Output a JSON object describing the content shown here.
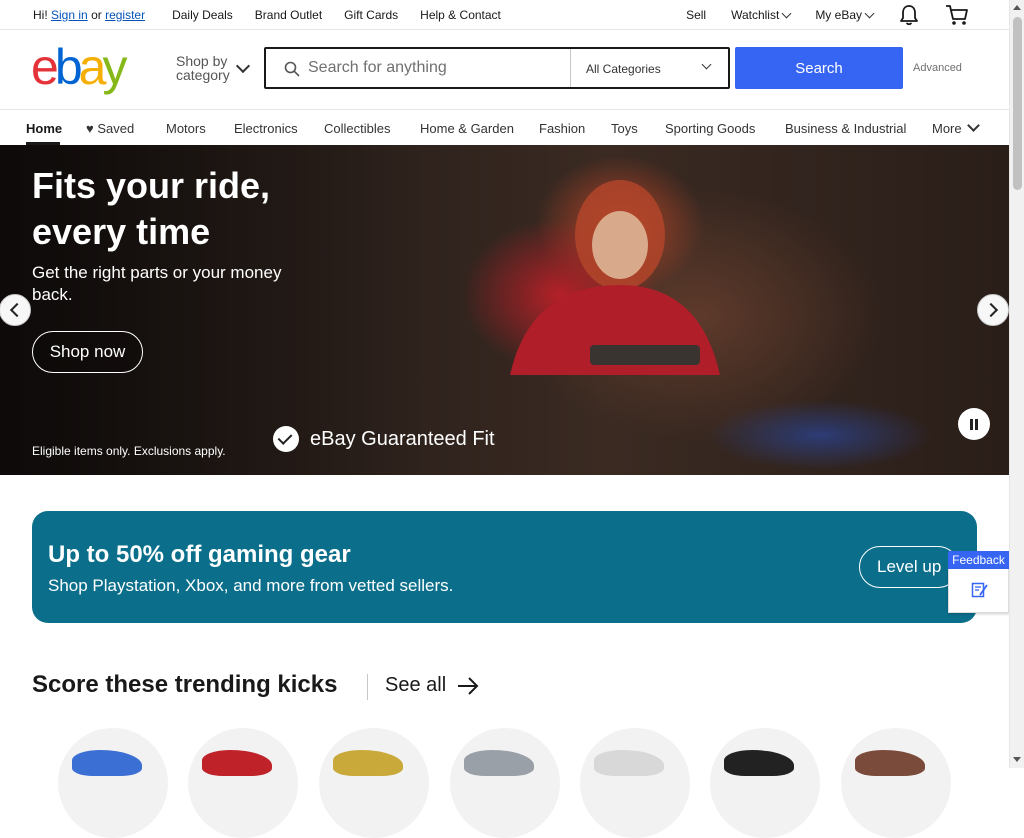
{
  "topbar": {
    "greeting_prefix": "Hi!",
    "sign_in": "Sign in",
    "or": "or",
    "register": "register",
    "links": [
      "Daily Deals",
      "Brand Outlet",
      "Gift Cards",
      "Help & Contact"
    ],
    "sell": "Sell",
    "watchlist": "Watchlist",
    "my_ebay": "My eBay"
  },
  "header": {
    "logo_letters": [
      "e",
      "b",
      "a",
      "y"
    ],
    "logo_colors": [
      "#e53238",
      "#0064d2",
      "#f5af02",
      "#86b817"
    ],
    "shop_by_line1": "Shop by",
    "shop_by_line2": "category",
    "search_placeholder": "Search for anything",
    "category_selected": "All Categories",
    "search_button": "Search",
    "advanced": "Advanced",
    "accent": "#3665f3"
  },
  "catnav": {
    "items": [
      "Home",
      "♥ Saved",
      "Motors",
      "Electronics",
      "Collectibles",
      "Home & Garden",
      "Fashion",
      "Toys",
      "Sporting Goods",
      "Business & Industrial",
      "More"
    ]
  },
  "hero": {
    "title": "Fits your ride, every time",
    "subtitle": "Get the right parts or your money back.",
    "cta": "Shop now",
    "disclaimer": "Eligible items only. Exclusions apply.",
    "badge": "eBay Guaranteed Fit"
  },
  "promo": {
    "title": "Up to 50% off gaming gear",
    "subtitle": "Shop Playstation, Xbox, and more from vetted sellers.",
    "cta": "Level up",
    "background": "#0b6f8c"
  },
  "feedback": {
    "label": "Feedback"
  },
  "trending": {
    "title": "Score these trending kicks",
    "see_all": "See all",
    "shoe_colors": [
      "#3b6fd4",
      "#c0222a",
      "#c9a93a",
      "#9aa0a8",
      "#d8d8d8",
      "#222222",
      "#7a4a3a"
    ]
  }
}
